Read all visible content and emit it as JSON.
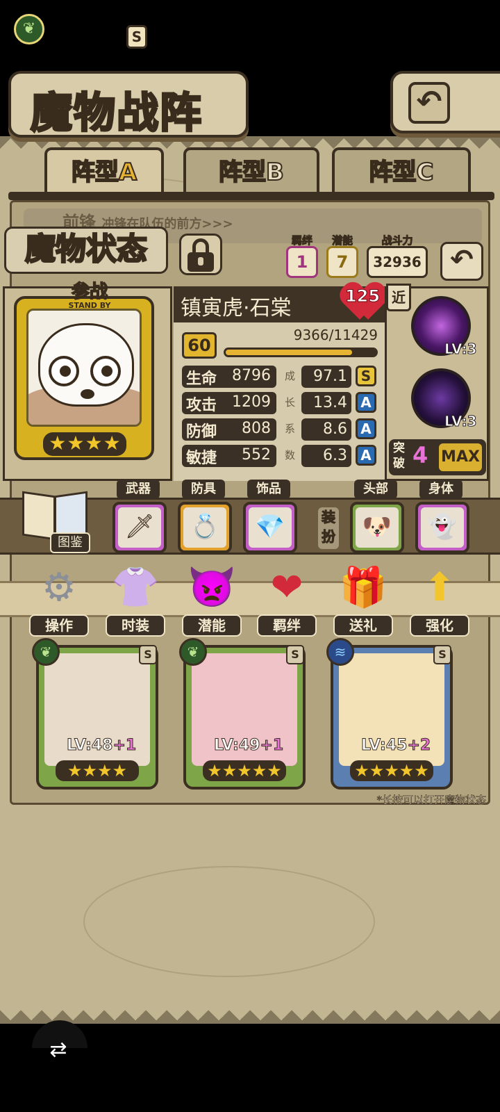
{
  "screen": {
    "title": "魔物战阵"
  },
  "formation_tabs": [
    {
      "label": "阵型",
      "letter": "A",
      "active": true
    },
    {
      "label": "阵型",
      "letter": "B",
      "active": false
    },
    {
      "label": "阵型",
      "letter": "C",
      "active": false
    }
  ],
  "front_row": {
    "label": "前锋",
    "hint": "冲锋在队伍的前方>>>"
  },
  "status_panel": {
    "title": "魔物状态",
    "bond": {
      "label": "羁绊",
      "value": "1"
    },
    "potential": {
      "label": "潜能",
      "value": "7"
    },
    "power": {
      "label": "战斗力",
      "value": "32936"
    }
  },
  "monster": {
    "name": "镇寅虎·石棠",
    "standby": "参战",
    "standby_en": "STAND BY",
    "grade": "S",
    "element_icon": "leaf-icon",
    "stars": 4,
    "affection": "125",
    "level": "60",
    "exp_text": "9366/11429",
    "exp_fraction": 0.819,
    "stats": [
      {
        "label": "生命",
        "value": "8796",
        "growth": "97.1",
        "rank": "S",
        "gchar": "成"
      },
      {
        "label": "攻击",
        "value": "1209",
        "growth": "13.4",
        "rank": "A",
        "gchar": "长"
      },
      {
        "label": "防御",
        "value": "808",
        "growth": "8.6",
        "rank": "A",
        "gchar": "系"
      },
      {
        "label": "敏捷",
        "value": "552",
        "growth": "6.3",
        "rank": "A",
        "gchar": "数"
      }
    ],
    "range_tag": "近",
    "skills": [
      {
        "level": "LV:3"
      },
      {
        "level": "LV:3"
      }
    ],
    "break": {
      "label": "突破",
      "value": "4",
      "max": "MAX"
    }
  },
  "equipment": {
    "codex": "图鉴",
    "slots": [
      {
        "label": "武器",
        "icon": "spear-icon",
        "glyph": "🗡"
      },
      {
        "label": "防具",
        "icon": "ring-icon",
        "glyph": "💍"
      },
      {
        "label": "饰品",
        "icon": "amulet-icon",
        "glyph": "💎"
      }
    ],
    "dress": "装扮",
    "cosmetic_slots": [
      {
        "label": "头部",
        "icon": "dog-head-icon",
        "glyph": "🐶"
      },
      {
        "label": "身体",
        "icon": "ghost-body-icon",
        "glyph": "👻"
      }
    ]
  },
  "actions": [
    {
      "label": "操作",
      "icon": "gear-icon",
      "glyph": "⚙",
      "color": "#8a8f98"
    },
    {
      "label": "时装",
      "icon": "outfit-icon",
      "glyph": "👚",
      "color": "#e89ad6"
    },
    {
      "label": "潜能",
      "icon": "potential-demon-icon",
      "glyph": "👿",
      "color": "#6a3aa2"
    },
    {
      "label": "羁绊",
      "icon": "hearts-icon",
      "glyph": "❤",
      "color": "#d22a3a"
    },
    {
      "label": "送礼",
      "icon": "gift-icon",
      "glyph": "🎁",
      "color": "#e8c43a"
    },
    {
      "label": "强化",
      "icon": "upgrade-arrows-icon",
      "glyph": "⬆",
      "color": "#f2c52a"
    }
  ],
  "team": [
    {
      "level": "LV:48",
      "plus": "+1",
      "stars": 4,
      "element_icon": "leaf-icon",
      "grade": "S",
      "art_color": "#e9dbc9"
    },
    {
      "level": "LV:49",
      "plus": "+1",
      "stars": 5,
      "element_icon": "leaf-icon",
      "grade": "S",
      "art_color": "#f0c3c8"
    },
    {
      "level": "LV:45",
      "plus": "+2",
      "stars": 5,
      "element_icon": "water-icon",
      "grade": "S",
      "art_color": "#f3e2b8"
    }
  ],
  "hint": "*长按可以打开魔物状态"
}
